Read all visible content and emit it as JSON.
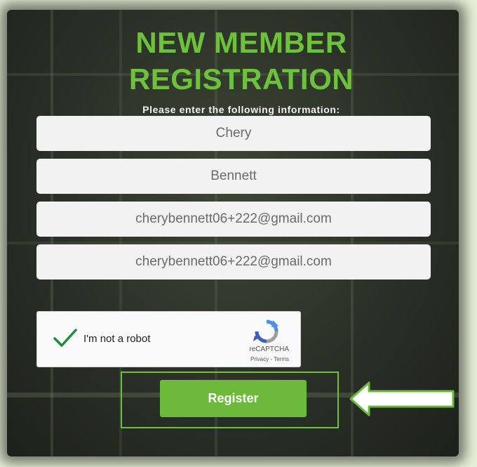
{
  "header": {
    "title_line1": "NEW MEMBER",
    "title_line2": "REGISTRATION",
    "subtitle": "Please enter the following information:"
  },
  "form": {
    "first_name": "Chery",
    "last_name": "Bennett",
    "email": "cherybennett06+222@gmail.com",
    "confirm_email": "cherybennett06+222@gmail.com"
  },
  "captcha": {
    "label": "I'm not a robot",
    "brand": "reCAPTCHA",
    "links": "Privacy - Terms",
    "checked": true
  },
  "actions": {
    "register_label": "Register"
  },
  "colors": {
    "accent_green": "#6cc23a",
    "button_green": "#6cb93b",
    "check_green": "#1e8e3e"
  },
  "icons": {
    "checkmark": "checkmark-icon",
    "recaptcha_logo": "recaptcha-logo-icon",
    "arrow": "arrow-left-icon"
  }
}
